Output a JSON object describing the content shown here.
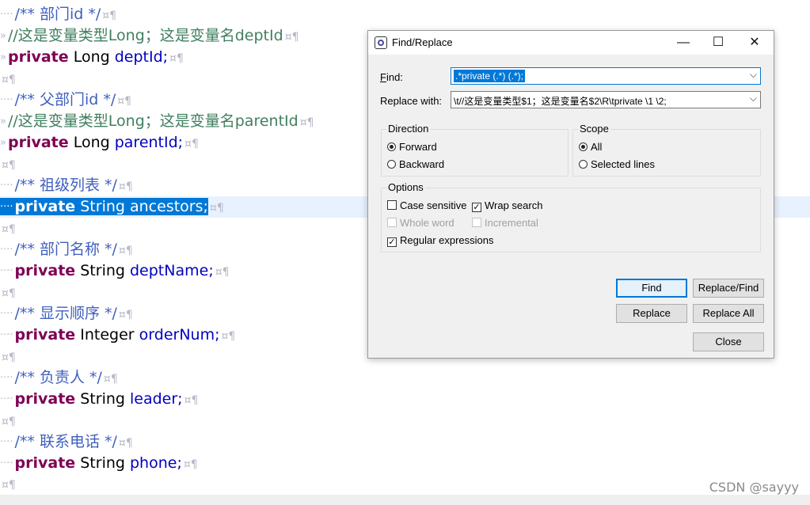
{
  "editor": {
    "lines": [
      {
        "text": "/** 部门id */"
      },
      {
        "text": "//这是变量类型Long；这是变量名deptId"
      },
      {
        "kw": "private",
        "type": "Long",
        "name": "deptId;"
      },
      {
        "text": ""
      },
      {
        "text": "/** 父部门id */"
      },
      {
        "text": "//这是变量类型Long；这是变量名parentId"
      },
      {
        "kw": "private",
        "type": "Long",
        "name": "parentId;"
      },
      {
        "text": ""
      },
      {
        "text": "/** 祖级列表 */"
      },
      {
        "kw": "private",
        "type": "String",
        "name": "ancestors;"
      },
      {
        "text": ""
      },
      {
        "text": "/** 部门名称 */"
      },
      {
        "kw": "private",
        "type": "String",
        "name": "deptName;"
      },
      {
        "text": ""
      },
      {
        "text": "/** 显示顺序 */"
      },
      {
        "kw": "private",
        "type": "Integer",
        "name": "orderNum;"
      },
      {
        "text": ""
      },
      {
        "text": "/** 负责人 */"
      },
      {
        "kw": "private",
        "type": "String",
        "name": "leader;"
      },
      {
        "text": ""
      },
      {
        "text": "/** 联系电话 */"
      },
      {
        "kw": "private",
        "type": "String",
        "name": "phone;"
      },
      {
        "text": ""
      }
    ],
    "eol_mark": "¤¶",
    "indent_dots": "····",
    "indent_tab": "»"
  },
  "watermark": "CSDN @sayyy",
  "dialog": {
    "title": "Find/Replace",
    "controls": {
      "minimize": "—",
      "maximize": "☐",
      "close": "✕"
    },
    "find_label": "Find:",
    "find_value": ".*private (.*) (.*);",
    "replace_label": "Replace with:",
    "replace_value": "\\t//这是变量类型$1；这是变量名$2\\R\\tprivate \\1 \\2;",
    "direction": {
      "title": "Direction",
      "forward": "Forward",
      "backward": "Backward"
    },
    "scope": {
      "title": "Scope",
      "all": "All",
      "selected_lines": "Selected lines"
    },
    "options": {
      "title": "Options",
      "case_sensitive": "Case sensitive",
      "wrap_search": "Wrap search",
      "whole_word": "Whole word",
      "incremental": "Incremental",
      "regular_expressions": "Regular expressions"
    },
    "buttons": {
      "find": "Find",
      "replace_find": "Replace/Find",
      "replace": "Replace",
      "replace_all": "Replace All",
      "close": "Close"
    }
  },
  "colors": {
    "keyword": "#7f0055",
    "javadoc": "#3f5fbf",
    "comment": "#3f7f5f",
    "field": "#0000c0",
    "selection": "#0078d7",
    "current_line": "#e8f2fe"
  }
}
